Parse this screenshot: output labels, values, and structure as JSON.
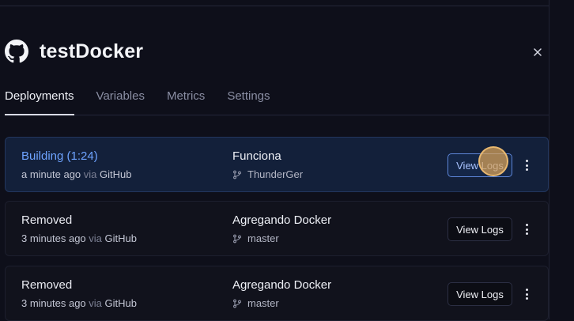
{
  "project": {
    "title": "testDocker",
    "close_icon": "close-icon",
    "logo_icon": "github-icon"
  },
  "tabs": [
    {
      "label": "Deployments",
      "active": true
    },
    {
      "label": "Variables",
      "active": false
    },
    {
      "label": "Metrics",
      "active": false
    },
    {
      "label": "Settings",
      "active": false
    }
  ],
  "deployments": [
    {
      "status": "Building (1:24)",
      "time": "a minute ago",
      "via_word": "via",
      "source": "GitHub",
      "commit": "Funciona",
      "branch": "ThunderGer",
      "button": "View Logs",
      "active": true
    },
    {
      "status": "Removed",
      "time": "3 minutes ago",
      "via_word": "via",
      "source": "GitHub",
      "commit": "Agregando Docker",
      "branch": "master",
      "button": "View Logs",
      "active": false
    },
    {
      "status": "Removed",
      "time": "3 minutes ago",
      "via_word": "via",
      "source": "GitHub",
      "commit": "Agregando Docker",
      "branch": "master",
      "button": "View Logs",
      "active": false
    }
  ],
  "colors": {
    "background": "#0e0f1a",
    "accent": "#6ea3ff",
    "active_card": "#13203a"
  }
}
